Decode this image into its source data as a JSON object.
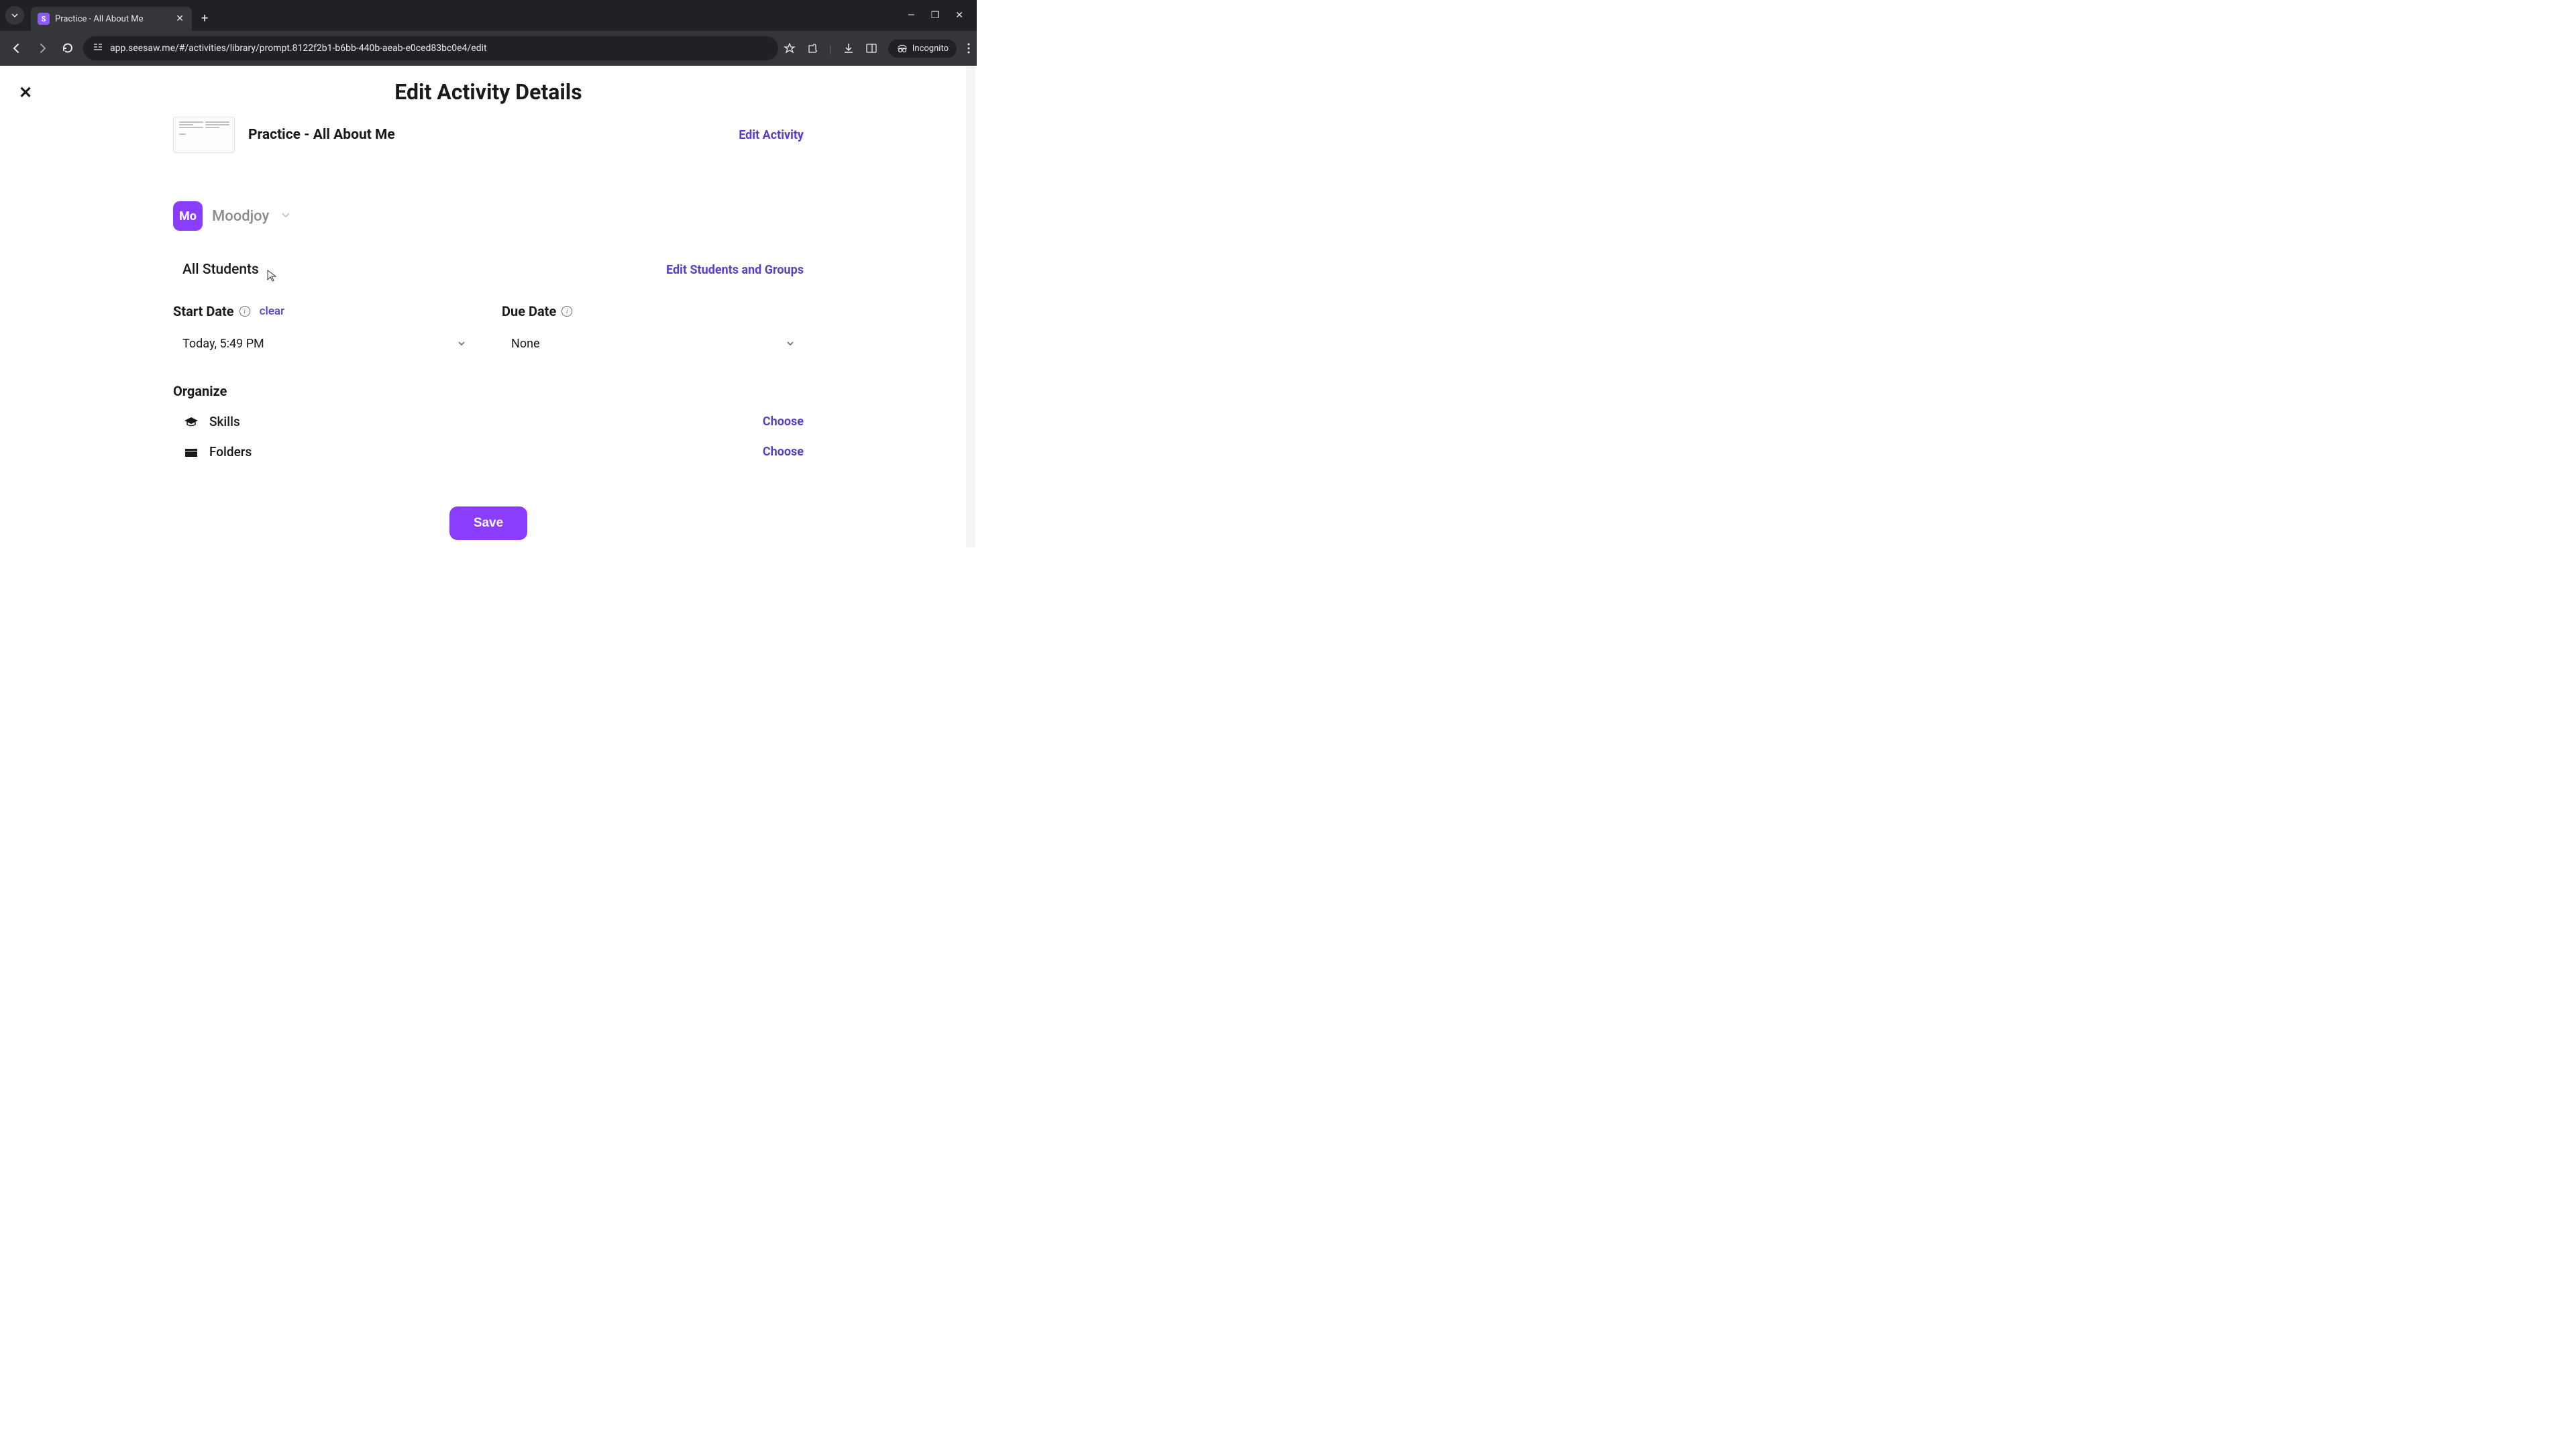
{
  "browser": {
    "tab_title": "Practice - All About Me",
    "url": "app.seesaw.me/#/activities/library/prompt.8122f2b1-b6bb-440b-aeab-e0ced83bc0e4/edit",
    "incognito_label": "Incognito"
  },
  "header": {
    "page_title": "Edit Activity Details"
  },
  "activity": {
    "name": "Practice - All About Me",
    "edit_link": "Edit Activity"
  },
  "class": {
    "badge": "Mo",
    "name": "Moodjoy"
  },
  "students": {
    "label": "All Students",
    "edit_link": "Edit Students and Groups"
  },
  "dates": {
    "start_label": "Start Date",
    "clear_label": "clear",
    "start_value": "Today, 5:49 PM",
    "due_label": "Due Date",
    "due_value": "None"
  },
  "organize": {
    "title": "Organize",
    "skills_label": "Skills",
    "folders_label": "Folders",
    "choose_label": "Choose"
  },
  "actions": {
    "save": "Save"
  }
}
